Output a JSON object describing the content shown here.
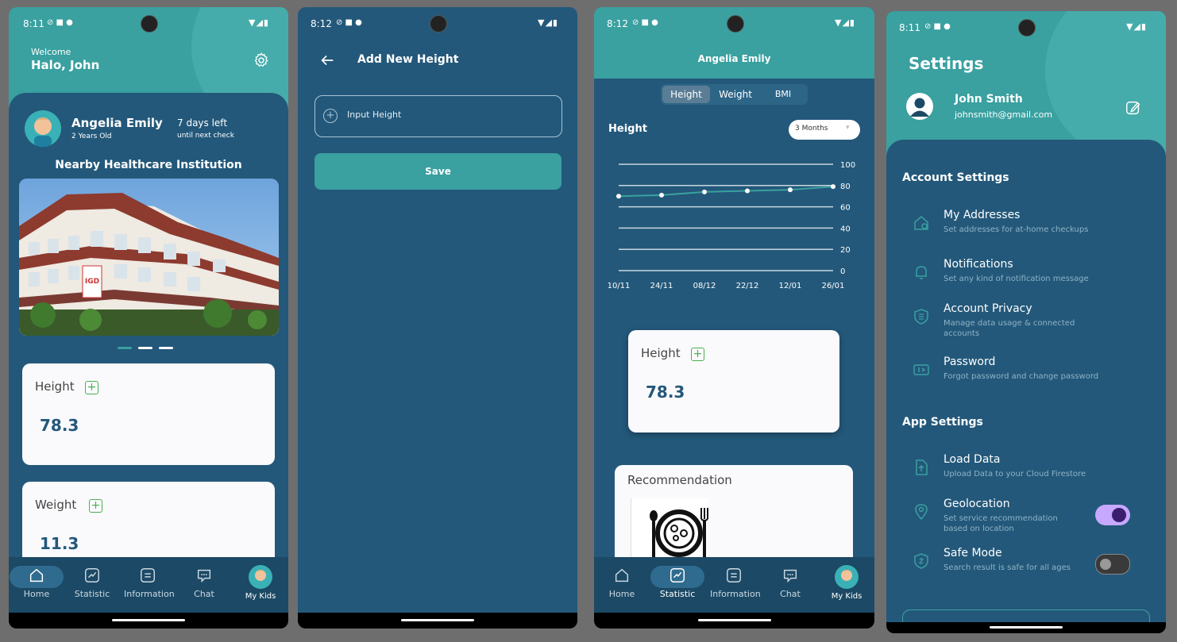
{
  "colors": {
    "teal": "#3aa0a0",
    "navy": "#23587a",
    "toggle_on": "#c6a8ff",
    "toggle_knob_on": "#3b1f6e"
  },
  "nav": {
    "home": "Home",
    "statistic": "Statistic",
    "information": "Information",
    "chat": "Chat",
    "mykids": "My Kids"
  },
  "screen1": {
    "time": "8:11",
    "welcome": "Welcome",
    "greeting": "Halo, John",
    "child_name": "Angelia Emily",
    "child_age": "2 Years Old",
    "days_left": "7 days left",
    "days_sub": "until next check",
    "section_title": "Nearby Healthcare Institution",
    "sign_text": "IGD",
    "height_label": "Height",
    "height_value": "78.3",
    "weight_label": "Weight",
    "weight_value": "11.3"
  },
  "screen2": {
    "time": "8:12",
    "title": "Add New Height",
    "input_placeholder": "Input Height",
    "save_label": "Save"
  },
  "screen3": {
    "time": "8:12",
    "title": "Angelia Emily",
    "tabs": [
      "Height",
      "Weight",
      "BMI"
    ],
    "chart_label": "Height",
    "range": "3 Months",
    "height_label": "Height",
    "height_value": "78.3",
    "recommendation_label": "Recommendation"
  },
  "chart_data": {
    "type": "line",
    "categories": [
      "10/11",
      "24/11",
      "08/12",
      "22/12",
      "12/01",
      "26/01"
    ],
    "series": [
      {
        "values": [
          70,
          71,
          74,
          75,
          76,
          79
        ]
      }
    ],
    "ylim": [
      0,
      100
    ],
    "yticks": [
      "100",
      "80",
      "60",
      "40",
      "20",
      "0"
    ],
    "grid": true
  },
  "screen4": {
    "time": "8:11",
    "title": "Settings",
    "user_name": "John Smith",
    "user_email": "johnsmith@gmail.com",
    "account_settings": "Account Settings",
    "app_settings": "App Settings",
    "account_items": [
      {
        "title": "My Addresses",
        "sub": "Set addresses for at-home checkups"
      },
      {
        "title": "Notifications",
        "sub": "Set any kind of notification message"
      },
      {
        "title": "Account Privacy",
        "sub": "Manage data usage & connected accounts"
      },
      {
        "title": "Password",
        "sub": "Forgot password and change password"
      }
    ],
    "app_items": [
      {
        "title": "Load Data",
        "sub": "Upload Data to your Cloud Firestore"
      },
      {
        "title": "Geolocation",
        "sub": "Set service recommendation based on location",
        "toggle": true
      },
      {
        "title": "Safe Mode",
        "sub": "Search result is safe for all ages",
        "toggle": false
      }
    ]
  }
}
